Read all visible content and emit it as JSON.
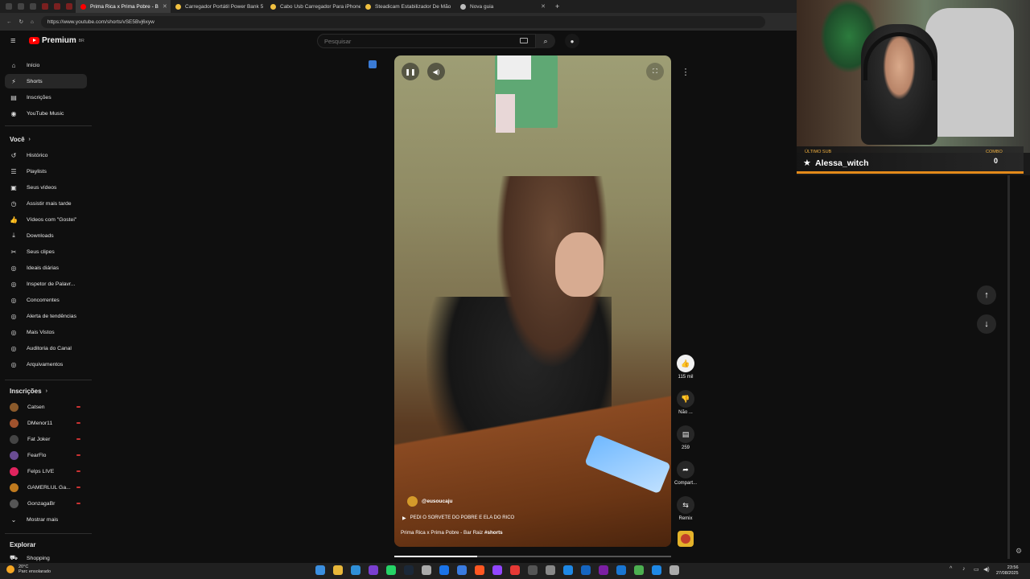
{
  "browser": {
    "tabs": [
      {
        "label": "Prima Rica x Prima Pobre - B",
        "active": true,
        "favicon_color": "#ff0000"
      },
      {
        "label": "Carregador Portátil Power Bank 5",
        "active": false,
        "favicon_color": "#f0c040"
      },
      {
        "label": "Cabo Usb Carregador Para iPhone",
        "active": false,
        "favicon_color": "#f0c040"
      },
      {
        "label": "Steadicam Estabilizador De Mão",
        "active": false,
        "favicon_color": "#f0c040"
      },
      {
        "label": "Nova guia",
        "active": false,
        "favicon_color": "#bbbbbb"
      }
    ],
    "url": "https://www.youtube.com/shorts/vSE5Bvj6xyw"
  },
  "header": {
    "logo_text": "Premium",
    "logo_sup": "BR",
    "search_placeholder": "Pesquisar"
  },
  "sidebar": {
    "main": [
      {
        "label": "Início",
        "icon": "home-icon",
        "glyph": "⌂"
      },
      {
        "label": "Shorts",
        "icon": "shorts-icon",
        "glyph": "⚡"
      },
      {
        "label": "Inscrições",
        "icon": "subscriptions-icon",
        "glyph": "▤"
      },
      {
        "label": "YouTube Music",
        "icon": "music-icon",
        "glyph": "◉"
      }
    ],
    "voce_title": "Você",
    "voce": [
      {
        "label": "Histórico",
        "icon": "history-icon",
        "glyph": "↺"
      },
      {
        "label": "Playlists",
        "icon": "playlist-icon",
        "glyph": "☰"
      },
      {
        "label": "Seus vídeos",
        "icon": "your-videos-icon",
        "glyph": "▣"
      },
      {
        "label": "Assistir mais tarde",
        "icon": "watch-later-icon",
        "glyph": "◷"
      },
      {
        "label": "Vídeos com \"Gostei\"",
        "icon": "liked-icon",
        "glyph": "👍"
      },
      {
        "label": "Downloads",
        "icon": "download-icon",
        "glyph": "⤓"
      },
      {
        "label": "Seus clipes",
        "icon": "clips-icon",
        "glyph": "✂"
      },
      {
        "label": "Ideais diárias",
        "icon": "ideas-icon",
        "glyph": "◎"
      },
      {
        "label": "Inspetor de Palavr...",
        "icon": "inspector-icon",
        "glyph": "◎"
      },
      {
        "label": "Concorrentes",
        "icon": "competitors-icon",
        "glyph": "◎"
      },
      {
        "label": "Alerta de tendências",
        "icon": "trends-icon",
        "glyph": "◎"
      },
      {
        "label": "Mais Vistos",
        "icon": "most-viewed-icon",
        "glyph": "◎"
      },
      {
        "label": "Auditoria do Canal",
        "icon": "audit-icon",
        "glyph": "◎"
      },
      {
        "label": "Arquivamentos",
        "icon": "archive-icon",
        "glyph": "◎"
      }
    ],
    "subs_title": "Inscrições",
    "subs": [
      {
        "label": "Catsen",
        "color": "#8b5a2b"
      },
      {
        "label": "DMenor11",
        "color": "#a0522d"
      },
      {
        "label": "Fat Joker",
        "color": "#444444"
      },
      {
        "label": "FearFlo",
        "color": "#6a4c93"
      },
      {
        "label": "Felps LIVE",
        "color": "#e0245e"
      },
      {
        "label": "GAMERLUL Ga...",
        "color": "#c07a1e"
      },
      {
        "label": "GonzagaBr",
        "color": "#555555"
      }
    ],
    "show_more": "Mostrar mais",
    "explore_title": "Explorar",
    "explore_first": "Shopping"
  },
  "video": {
    "channel": "@eusoucaju",
    "music": "PEDI O SORVETE DO POBRE E ELA DO RICO",
    "title": "Prima Rica x Prima Pobre - Bar Raiz",
    "hashtag": "#shorts",
    "progress": 0.3
  },
  "actions": {
    "like_count": "115 mil",
    "dislike_label": "Não ...",
    "comments_count": "259",
    "share_label": "Compart...",
    "remix_label": "Remix"
  },
  "overlay": {
    "last_sub_label": "ÚLTIMO SUB",
    "last_sub_name": "Alessa_witch",
    "combo_label": "COMBO",
    "combo_value": "0"
  },
  "taskbar": {
    "weather_temp": "20°C",
    "weather_desc": "Parc ensolarado",
    "time": "23:56",
    "date": "27/08/2025"
  }
}
